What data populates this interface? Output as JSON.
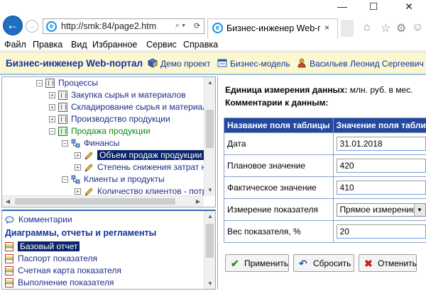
{
  "window": {
    "minimize": "—",
    "maximize": "☐",
    "close": "✕"
  },
  "browser": {
    "url": "http://smk:84/page2.htm",
    "tab_title": "Бизнес-инженер Web-по...",
    "tab_close": "×",
    "search_ctl": "⌕ ▾",
    "refresh_ctl": "⟳"
  },
  "menu": [
    "Файл",
    "Правка",
    "Вид",
    "Избранное",
    "Сервис",
    "Справка"
  ],
  "header": {
    "brand": "Бизнес-инженер Web-портал",
    "links": {
      "demo": "Демо проект",
      "model": "Бизнес-модель",
      "user": "Васильев Леонид Сергеевич"
    }
  },
  "tree": {
    "items": [
      {
        "label": "Процессы",
        "level": 0,
        "expander": "−",
        "icon": "process"
      },
      {
        "label": "Закупка сырья и материалов",
        "level": 1,
        "expander": "+",
        "icon": "process"
      },
      {
        "label": "Складирование сырья и материалов",
        "level": 1,
        "expander": "+",
        "icon": "process"
      },
      {
        "label": "Производство продукции",
        "level": 1,
        "expander": "+",
        "icon": "process"
      },
      {
        "label": "Продажа продукции",
        "level": 1,
        "expander": "−",
        "icon": "process-active"
      },
      {
        "label": "Финансы",
        "level": 2,
        "expander": "−",
        "icon": "group"
      },
      {
        "label": "Объем продаж продукции",
        "level": 3,
        "expander": "+",
        "icon": "indicator",
        "selected": true
      },
      {
        "label": "Степень снижения затрат на",
        "level": 3,
        "expander": "+",
        "icon": "indicator"
      },
      {
        "label": "Клиенты и продукты",
        "level": 2,
        "expander": "−",
        "icon": "group"
      },
      {
        "label": "Количество клиентов - потре",
        "level": 3,
        "expander": "+",
        "icon": "indicator"
      }
    ]
  },
  "bottom_left": {
    "comments_label": "Комментарии",
    "section_title": "Диаграммы, отчеты и регламенты",
    "reports": [
      {
        "label": "Базовый отчет",
        "selected": true
      },
      {
        "label": "Паспорт показателя"
      },
      {
        "label": "Счетная карта показателя"
      },
      {
        "label": "Выполнение показателя"
      }
    ]
  },
  "details": {
    "unit_label": "Единица измерения данных:",
    "unit_value": "млн. руб. в мес.",
    "comments_label": "Комментарии к данным:",
    "col_name": "Название поля таблицы",
    "col_value": "Значение поля таблицы",
    "rows": [
      {
        "name": "Дата",
        "value": "31.01.2018"
      },
      {
        "name": "Плановое значение",
        "value": "420"
      },
      {
        "name": "Фактическое значение",
        "value": "410"
      },
      {
        "name": "Измерение показателя",
        "value": "Прямое измерение"
      },
      {
        "name": "Вес показателя, %",
        "value": "20"
      }
    ],
    "buttons": {
      "apply": "Применить",
      "reset": "Сбросить",
      "cancel": "Отменить"
    }
  },
  "colors": {
    "brand": "#13329d",
    "header_bg": "#fbf7cf",
    "table_header": "#24489b",
    "selection": "#0a246a",
    "green": "#0a8a16"
  }
}
